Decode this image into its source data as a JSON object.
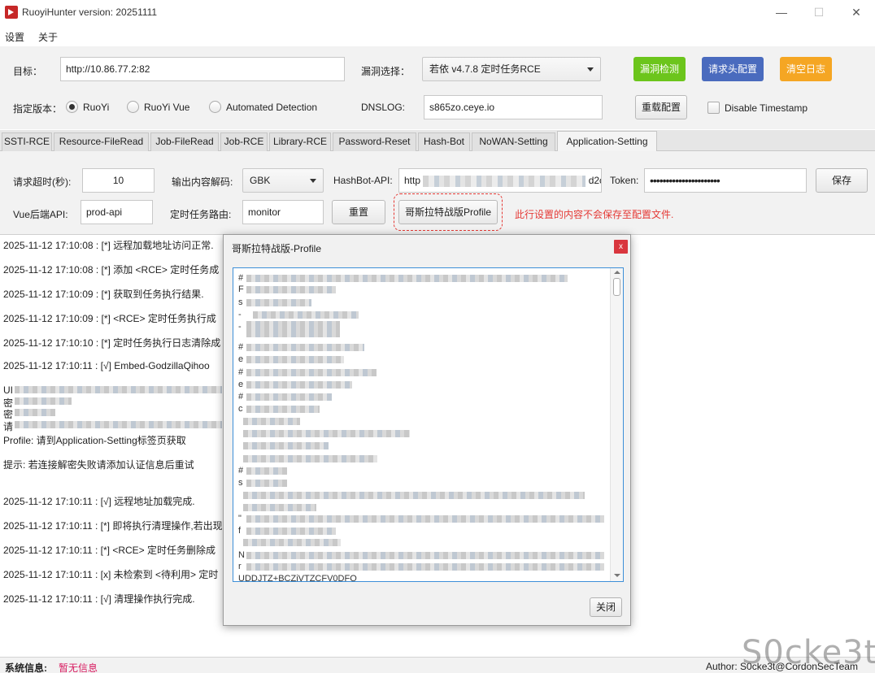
{
  "window": {
    "title": "RuoyiHunter version: 20251111",
    "minimize": "—",
    "maximize": "☐",
    "close": "✕"
  },
  "menu": {
    "settings": "设置",
    "about": "关于"
  },
  "config": {
    "target_label": "目标：",
    "target_value": "http://10.86.77.2:82",
    "vuln_label": "漏洞选择：",
    "vuln_value": "若依 v4.7.8 定时任务RCE",
    "detect_btn": "漏洞检测",
    "header_btn": "请求头配置",
    "clear_btn": "清空日志",
    "version_label": "指定版本：",
    "version_options": [
      "RuoYi",
      "RuoYi Vue",
      "Automated Detection"
    ],
    "version_selected": "RuoYi",
    "dnslog_label": "DNSLOG:",
    "dnslog_value": "s865zo.ceye.io",
    "reload_btn": "重载配置",
    "disable_ts_label": "Disable Timestamp",
    "disable_ts_checked": false
  },
  "tabs": [
    "SSTI-RCE",
    "Resource-FileRead",
    "Job-FileRead",
    "Job-RCE",
    "Library-RCE",
    "Password-Reset",
    "Hash-Bot",
    "NoWAN-Setting",
    "Application-Setting"
  ],
  "active_tab": "Application-Setting",
  "settings": {
    "timeout_label": "请求超时(秒):",
    "timeout_value": "10",
    "decode_label": "输出内容解码:",
    "decode_value": "GBK",
    "hashbot_label": "HashBot-API:",
    "hashbot_prefix": "http",
    "hashbot_suffix": "d2c",
    "token_label": "Token:",
    "token_value": "••••••••••••••••••••••",
    "save_btn": "保存",
    "vue_api_label": "Vue后端API:",
    "vue_api_value": "prod-api",
    "job_route_label": "定时任务路由:",
    "job_route_value": "monitor",
    "reset_btn": "重置",
    "profile_btn": "哥斯拉特战版Profile",
    "note": "此行设置的内容不会保存至配置文件."
  },
  "log_lines": [
    "2025-11-12 17:10:08 : [*] 远程加载地址访问正常.",
    "2025-11-12 17:10:08 : [*] 添加 <RCE> 定时任务成",
    "2025-11-12 17:10:09 : [*] 获取到任务执行结果.",
    "2025-11-12 17:10:09 : [*] <RCE> 定时任务执行成",
    "2025-11-12 17:10:10 : [*] 定时任务执行日志清除成",
    "2025-11-12 17:10:11 : [√] Embed-GodzillaQihoo",
    "UI",
    "密",
    "密",
    "请",
    "Profile: 请到Application-Setting标签页获取",
    "提示: 若连接解密失败请添加认证信息后重试",
    "2025-11-12 17:10:11 : [√] 远程地址加载完成.",
    "2025-11-12 17:10:11 : [*] 即将执行清理操作,若出现",
    "2025-11-12 17:10:11 : [*] <RCE> 定时任务删除成",
    "2025-11-12 17:10:11 : [x] 未检索到 <待利用> 定时",
    "2025-11-12 17:10:11 : [√] 清理操作执行完成."
  ],
  "status": {
    "label": "系统信息:",
    "value": "暂无信息",
    "author": "Author: S0cke3t@CordonSecTeam"
  },
  "dialog": {
    "title": "哥斯拉特战版-Profile",
    "close_x": "x",
    "profile_lines": [
      "#",
      "F",
      "s",
      "-",
      "-",
      "#",
      "e",
      "#",
      "e",
      "#",
      "c",
      "#",
      "s",
      "\"",
      "f",
      "N",
      "r",
      "UDDJTZ+BCZiVTZCFV0DFQ"
    ],
    "close_btn": "关闭"
  },
  "watermark": "S0cke3t",
  "colors": {
    "detect": "#6cc51c",
    "header": "#4a6bbe",
    "clear": "#f5a623",
    "accent": "#e53935",
    "focus": "#3d8fd8"
  }
}
